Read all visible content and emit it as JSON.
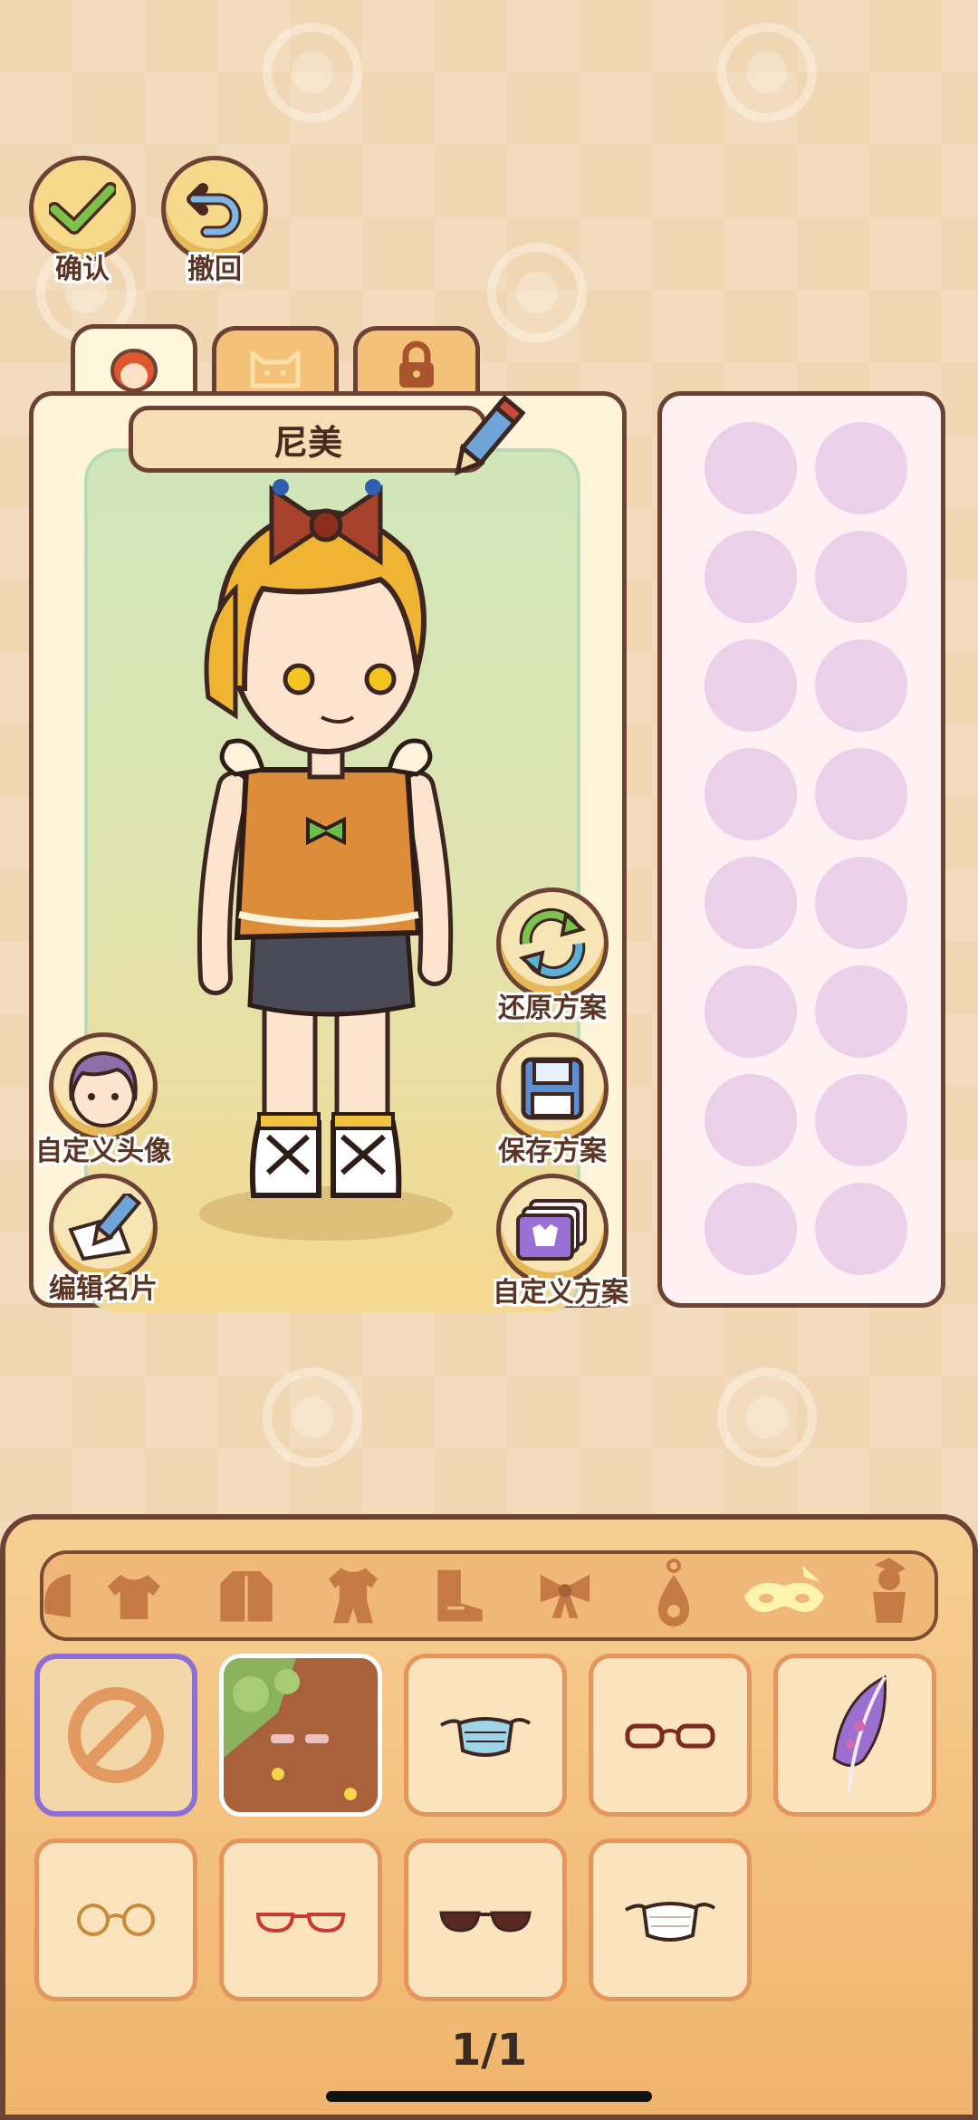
{
  "top_buttons": {
    "confirm": "确认",
    "undo": "撤回"
  },
  "tabs": [
    {
      "icon": "character-icon",
      "active": true
    },
    {
      "icon": "cat-icon",
      "active": false
    },
    {
      "icon": "lock-icon",
      "active": false
    }
  ],
  "character": {
    "name": "尼美"
  },
  "actions": {
    "restore": "还原方案",
    "save": "保存方案",
    "custom_scheme": "自定义方案",
    "custom_avatar": "自定义头像",
    "edit_card": "编辑名片"
  },
  "categories": [
    "partial-icon",
    "shirt-icon",
    "coat-icon",
    "outfit-icon",
    "boots-icon",
    "bow-icon",
    "earring-icon",
    "mask-icon",
    "figure-icon"
  ],
  "selected_category": "mask-icon",
  "items": [
    {
      "icon": "none-icon",
      "selected": true
    },
    {
      "icon": "mosaic-glasses-icon",
      "selected": false
    },
    {
      "icon": "blue-mask-icon",
      "selected": false
    },
    {
      "icon": "red-glasses-icon",
      "selected": false
    },
    {
      "icon": "feather-icon",
      "selected": false
    },
    {
      "icon": "round-glasses-icon",
      "selected": false
    },
    {
      "icon": "red-thin-glasses-icon",
      "selected": false
    },
    {
      "icon": "sunglasses-icon",
      "selected": false
    },
    {
      "icon": "white-mask-icon",
      "selected": false
    }
  ],
  "pagination": "1/1",
  "colors": {
    "outline": "#6b4233",
    "selection": "#8b6fd6",
    "accent": "#f0b878"
  }
}
